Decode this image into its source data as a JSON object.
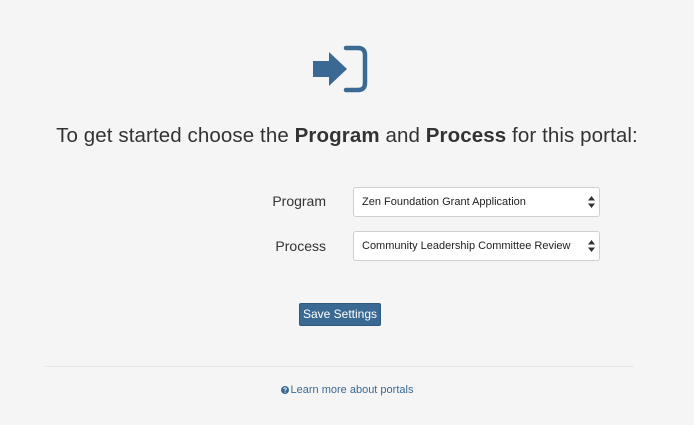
{
  "header": {
    "icon": "sign-in-icon",
    "heading_prefix": "To get started choose the ",
    "heading_program": "Program",
    "heading_and": " and ",
    "heading_process": "Process",
    "heading_suffix": " for this portal:"
  },
  "form": {
    "program_label": "Program",
    "program_value": "Zen Foundation Grant Application",
    "process_label": "Process",
    "process_value": "Community Leadership Committee Review",
    "save_label": "Save Settings"
  },
  "footer": {
    "learn_more_icon": "question-circle-icon",
    "learn_more_label": "Learn more about portals"
  },
  "colors": {
    "accent": "#3a6a93",
    "background": "#f5f5f5",
    "text": "#333333"
  }
}
